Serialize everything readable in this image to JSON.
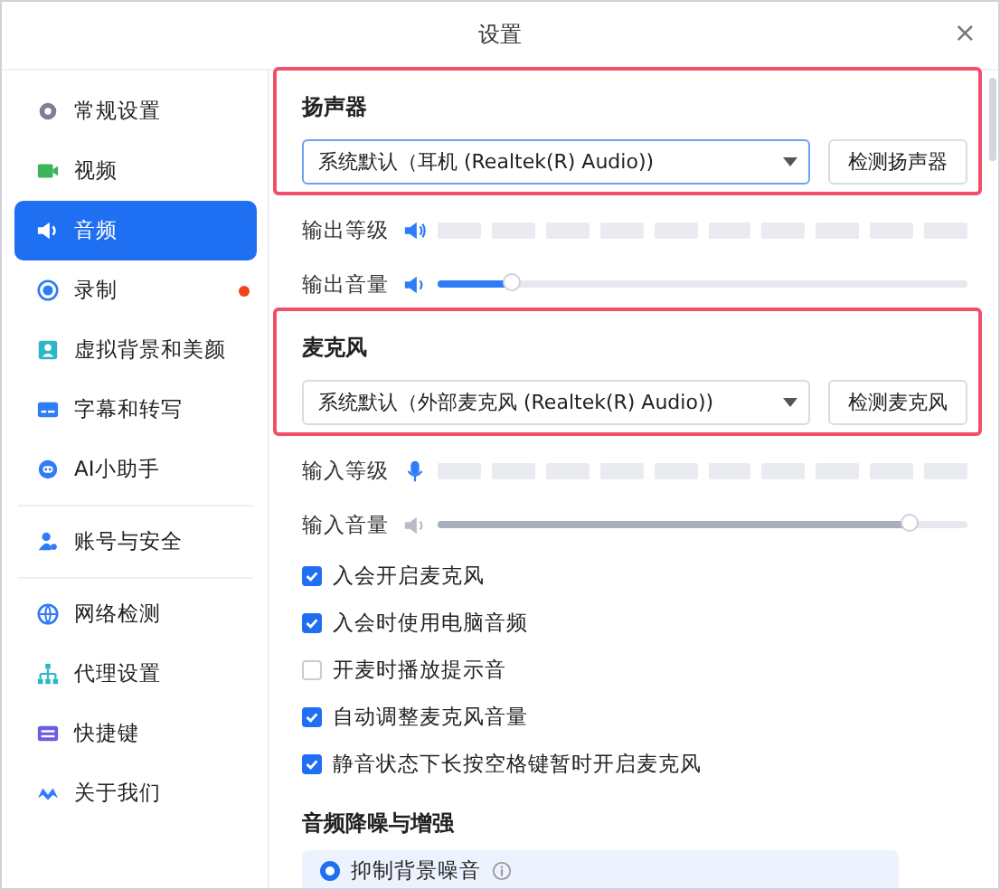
{
  "window": {
    "title": "设置",
    "close": "×"
  },
  "sidebar": {
    "groups": [
      {
        "items": [
          {
            "label": "常规设置",
            "selected": false,
            "badge": false
          },
          {
            "label": "视频",
            "selected": false,
            "badge": false
          },
          {
            "label": "音频",
            "selected": true,
            "badge": false
          },
          {
            "label": "录制",
            "selected": false,
            "badge": true
          },
          {
            "label": "虚拟背景和美颜",
            "selected": false,
            "badge": false
          },
          {
            "label": "字幕和转写",
            "selected": false,
            "badge": false
          },
          {
            "label": "AI小助手",
            "selected": false,
            "badge": false
          }
        ]
      },
      {
        "items": [
          {
            "label": "账号与安全",
            "selected": false,
            "badge": false
          }
        ]
      },
      {
        "items": [
          {
            "label": "网络检测",
            "selected": false,
            "badge": false
          },
          {
            "label": "代理设置",
            "selected": false,
            "badge": false
          },
          {
            "label": "快捷键",
            "selected": false,
            "badge": false
          },
          {
            "label": "关于我们",
            "selected": false,
            "badge": false
          }
        ]
      }
    ]
  },
  "speaker": {
    "title": "扬声器",
    "highlighted": true,
    "device": "系统默认（耳机 (Realtek(R) Audio))",
    "test_button": "检测扬声器",
    "level_label": "输出等级",
    "volume_label": "输出音量",
    "volume": {
      "level": 0.14,
      "disabled": false
    }
  },
  "microphone": {
    "title": "麦克风",
    "highlighted": true,
    "device": "系统默认（外部麦克风 (Realtek(R) Audio))",
    "test_button": "检测麦克风",
    "level_label": "输入等级",
    "volume_label": "输入音量",
    "volume": {
      "level": 0.89,
      "disabled": true
    }
  },
  "options": [
    {
      "label": "入会开启麦克风",
      "checked": true
    },
    {
      "label": "入会时使用电脑音频",
      "checked": true
    },
    {
      "label": "开麦时播放提示音",
      "checked": false
    },
    {
      "label": "自动调整麦克风音量",
      "checked": true
    },
    {
      "label": "静音状态下长按空格键暂时开启麦克风",
      "checked": true
    }
  ],
  "noise": {
    "title": "音频降噪与增强",
    "choices": [
      {
        "label": "抑制背景噪音",
        "selected": true
      }
    ]
  }
}
